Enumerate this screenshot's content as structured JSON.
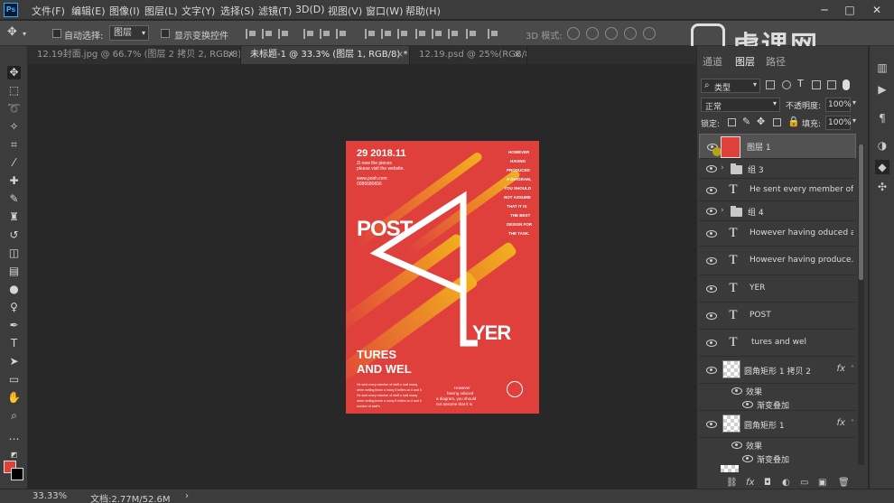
{
  "menubar": {
    "app_icon": "Ps",
    "items": [
      "文件(F)",
      "编辑(E)",
      "图像(I)",
      "图层(L)",
      "文字(Y)",
      "选择(S)",
      "滤镜(T)",
      "3D(D)",
      "视图(V)",
      "窗口(W)",
      "帮助(H)"
    ]
  },
  "options": {
    "auto_select_label": "自动选择:",
    "auto_select_value": "图层",
    "show_transform_label": "显示变换控件",
    "mode3d_label": "3D 模式:"
  },
  "tabs": [
    {
      "label": "12.19封面.jpg @ 66.7% (图层 2 拷贝 2, RGB/8) *"
    },
    {
      "label": "未标题-1 @ 33.3% (图层 1, RGB/8) *"
    },
    {
      "label": "12.19.psd @ 25%(RGB/8) *"
    }
  ],
  "status": {
    "zoom": "33.33%",
    "doc": "文档:2.77M/52.6M"
  },
  "watermark": {
    "text": "虎课网"
  },
  "panel": {
    "tabs": [
      "通道",
      "图层",
      "路径"
    ],
    "filter_kind": "类型",
    "blend_mode": "正常",
    "opacity_label": "不透明度:",
    "opacity_value": "100%",
    "lock_label": "锁定:",
    "fill_label": "填充:",
    "fill_value": "100%",
    "layers": [
      {
        "name": "图层 1",
        "type": "image"
      },
      {
        "name": "组 3",
        "type": "group"
      },
      {
        "name": "He sent every member of...",
        "type": "text"
      },
      {
        "name": "组 4",
        "type": "group"
      },
      {
        "name": "However having oduced a...",
        "type": "text"
      },
      {
        "name": "However having produce...",
        "type": "text"
      },
      {
        "name": "YER",
        "type": "text"
      },
      {
        "name": "POST",
        "type": "text"
      },
      {
        "name": "tures and wel",
        "type": "text"
      },
      {
        "name": "圆角矩形 1 拷贝 2",
        "type": "shape",
        "effects_label": "效果",
        "effect": "渐变叠加",
        "fx": "fx"
      },
      {
        "name": "圆角矩形 1",
        "type": "shape",
        "effects_label": "效果",
        "effect": "渐变叠加",
        "fx": "fx"
      }
    ]
  },
  "poster": {
    "date": "29 2018.11",
    "subtitle1": "Zi new the pieces",
    "subtitle2": "please visit the website.",
    "url": "www.posh.com",
    "phone": "0086680656",
    "right_lines": [
      "HOWEVER",
      "HAVING",
      "PRODUCED",
      "A DIAGRAM,",
      "YOU SHOULD",
      "NOT ASSUME",
      "THAT IT IS",
      "THE BEST",
      "DESIGN FOR",
      "THE TASK."
    ],
    "post": "POST",
    "yer": "YER",
    "tures": "TURES",
    "and_wel": "AND WEL",
    "bl_lines": [
      "He sent every member of staff a mail essay",
      "when writing these a many 5 brilles on it and it",
      "He sent every member of staff a mail essay",
      "when writing these a many 5 brilles on it and it",
      "number of staff's"
    ],
    "br_lines": [
      "However",
      "having oduced",
      "a diagram, you should",
      "not assume that it is"
    ],
    "colors": {
      "bg": "#e0403c",
      "accent": "#f2b01e"
    }
  }
}
